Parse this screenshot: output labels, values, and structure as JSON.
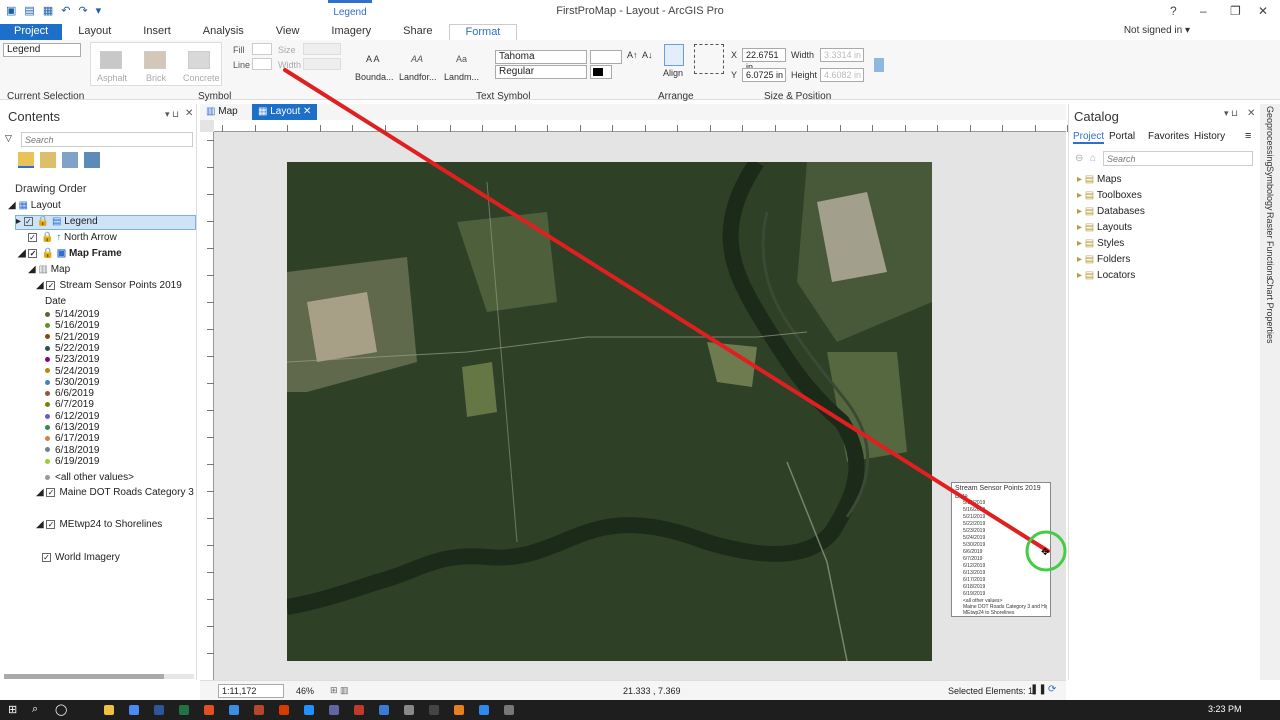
{
  "window": {
    "title": "FirstProMap - Layout - ArcGIS Pro",
    "context_tab": "Legend",
    "help": "?",
    "minimize": "–",
    "restore": "❐",
    "close": "✕"
  },
  "ribbon_tabs": [
    "Project",
    "Layout",
    "Insert",
    "Analysis",
    "View",
    "Imagery",
    "Share",
    "Format"
  ],
  "signin": "Not signed in ▾",
  "ribbon": {
    "current_selection": {
      "value": "Legend",
      "label": "Current Selection"
    },
    "symbol": {
      "label": "Symbol",
      "fill_label": "Fill",
      "line_label": "Line",
      "size_label": "Size",
      "width_label": "Width",
      "swatches": [
        {
          "name": "Asphalt",
          "color": "#c8c8c8"
        },
        {
          "name": "Brick",
          "color": "#d5c7b8"
        },
        {
          "name": "Concrete",
          "color": "#d8d8d8"
        }
      ]
    },
    "text_symbol": {
      "label": "Text Symbol",
      "styles": [
        "Bounda...",
        "Landfor...",
        "Landm..."
      ],
      "sample_glyphs": [
        "A A",
        "AA",
        "Aa"
      ],
      "font": "Tahoma",
      "style": "Regular"
    },
    "arrange": {
      "label": "Arrange",
      "button": "Align"
    },
    "size_position": {
      "label": "Size & Position",
      "x_label": "X",
      "x_value": "22.6751 in",
      "y_label": "Y",
      "y_value": "6.0725 in",
      "width_label": "Width",
      "height_label": "Height",
      "width_value": "3.3314 in",
      "height_value": "4.6082 in"
    }
  },
  "contents": {
    "title": "Contents",
    "search_placeholder": "Search",
    "drawing_order": "Drawing Order",
    "tree": {
      "layout": "Layout",
      "legend": "Legend",
      "north_arrow": "North Arrow",
      "map_frame": "Map Frame",
      "map": "Map",
      "stream_layer": "Stream Sensor Points 2019",
      "date_field": "Date",
      "dates": [
        "5/14/2019",
        "5/16/2019",
        "5/21/2019",
        "5/22/2019",
        "5/23/2019",
        "5/24/2019",
        "5/30/2019",
        "6/6/2019",
        "6/7/2019",
        "6/12/2019",
        "6/13/2019",
        "6/17/2019",
        "6/18/2019",
        "6/19/2019"
      ],
      "all_other": "<all other values>",
      "roads_layer": "Maine DOT Roads Category 3 and Highe",
      "shore_layer": "MEtwp24 to Shorelines",
      "imagery_layer": "World Imagery"
    }
  },
  "view_tabs": {
    "map": "Map",
    "layout": "Layout"
  },
  "legend_element": {
    "title": "Stream Sensor Points 2019",
    "date": "Date",
    "all_other": "<all other values>",
    "roads": "Maine DOT Roads Category 3 and Higher Lines",
    "shore": "MEtwp24 to Shorelines"
  },
  "catalog": {
    "title": "Catalog",
    "tabs": [
      "Project",
      "Portal",
      "Favorites",
      "History"
    ],
    "search_placeholder": "Search",
    "items": [
      "Maps",
      "Toolboxes",
      "Databases",
      "Layouts",
      "Styles",
      "Folders",
      "Locators"
    ]
  },
  "right_sidebar": [
    "Geoprocessing",
    "Symbology",
    "Raster Functions",
    "Chart Properties"
  ],
  "status": {
    "scale": "1:11,172",
    "zoom": "46%",
    "coords": "21.333 , 7.369",
    "selected": "Selected Elements: 1"
  },
  "taskbar": {
    "time": "3:23 PM"
  },
  "colors": {
    "accent": "#1d6fc8",
    "drag_line": "#e02020",
    "cursor_ring": "#44cc44"
  }
}
